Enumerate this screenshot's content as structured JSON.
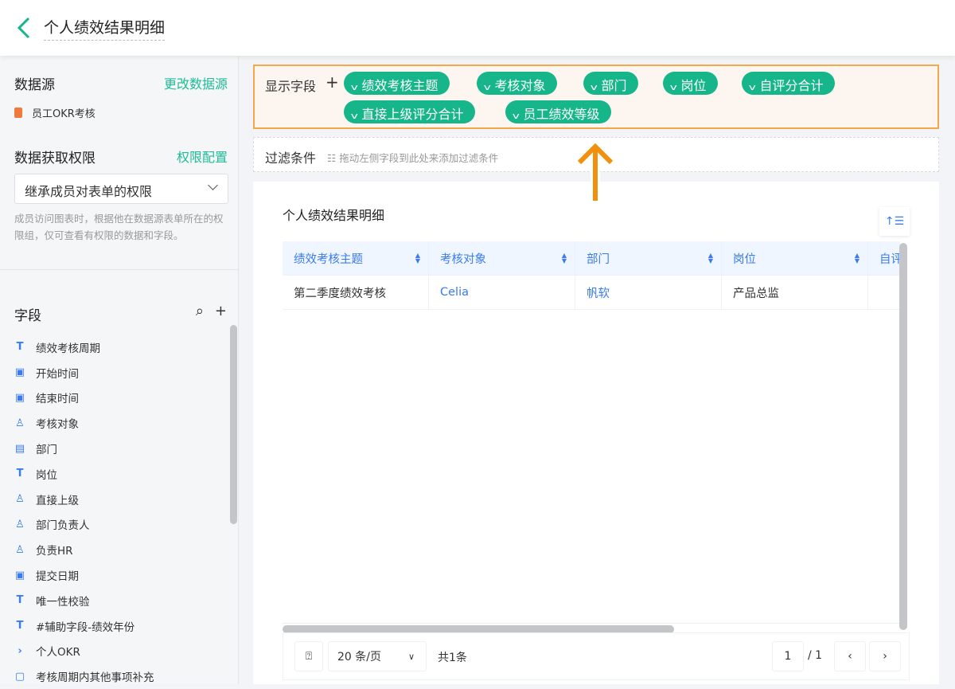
{
  "header": {
    "title": "个人绩效结果明细"
  },
  "sidebar": {
    "datasource_label": "数据源",
    "change_datasource": "更改数据源",
    "datasource_name": "员工OKR考核",
    "permission_label": "数据获取权限",
    "permission_config": "权限配置",
    "permission_value": "继承成员对表单的权限",
    "permission_hint": "成员访问图表时，根据他在数据源表单所在的权限组，仅可查看有权限的数据和字段。",
    "fields_label": "字段",
    "fields": [
      {
        "icon": "T",
        "label": "绩效考核周期"
      },
      {
        "icon": "▣",
        "label": "开始时间"
      },
      {
        "icon": "▣",
        "label": "结束时间"
      },
      {
        "icon": "♙",
        "label": "考核对象"
      },
      {
        "icon": "▤",
        "label": "部门"
      },
      {
        "icon": "T",
        "label": "岗位"
      },
      {
        "icon": "♙",
        "label": "直接上级"
      },
      {
        "icon": "♙",
        "label": "部门负责人"
      },
      {
        "icon": "♙",
        "label": "负责HR"
      },
      {
        "icon": "▣",
        "label": "提交日期"
      },
      {
        "icon": "T",
        "label": "唯一性校验"
      },
      {
        "icon": "T",
        "label": "#辅助字段-绩效年份"
      },
      {
        "icon": "›",
        "label": "个人OKR"
      },
      {
        "icon": "▢",
        "label": "考核周期内其他事项补充"
      }
    ]
  },
  "display": {
    "label": "显示字段",
    "chips": [
      "绩效考核主题",
      "考核对象",
      "部门",
      "岗位",
      "自评分合计",
      "直接上级评分合计",
      "员工绩效等级"
    ]
  },
  "filter": {
    "label": "过滤条件",
    "hint": "拖动左侧字段到此处来添加过滤条件"
  },
  "table": {
    "title": "个人绩效结果明细",
    "columns": [
      "绩效考核主题",
      "考核对象",
      "部门",
      "岗位",
      "自评分合计"
    ],
    "rows": [
      [
        "第二季度绩效考核",
        "Celia",
        "帆软",
        "产品总监",
        ""
      ]
    ]
  },
  "pager": {
    "page_size": "20 条/页",
    "total": "共1条",
    "page": "1",
    "pages": "/ 1"
  },
  "colors": {
    "accent": "#16b68a",
    "highlight": "#f5a84a",
    "blue": "#3a7bf2"
  }
}
